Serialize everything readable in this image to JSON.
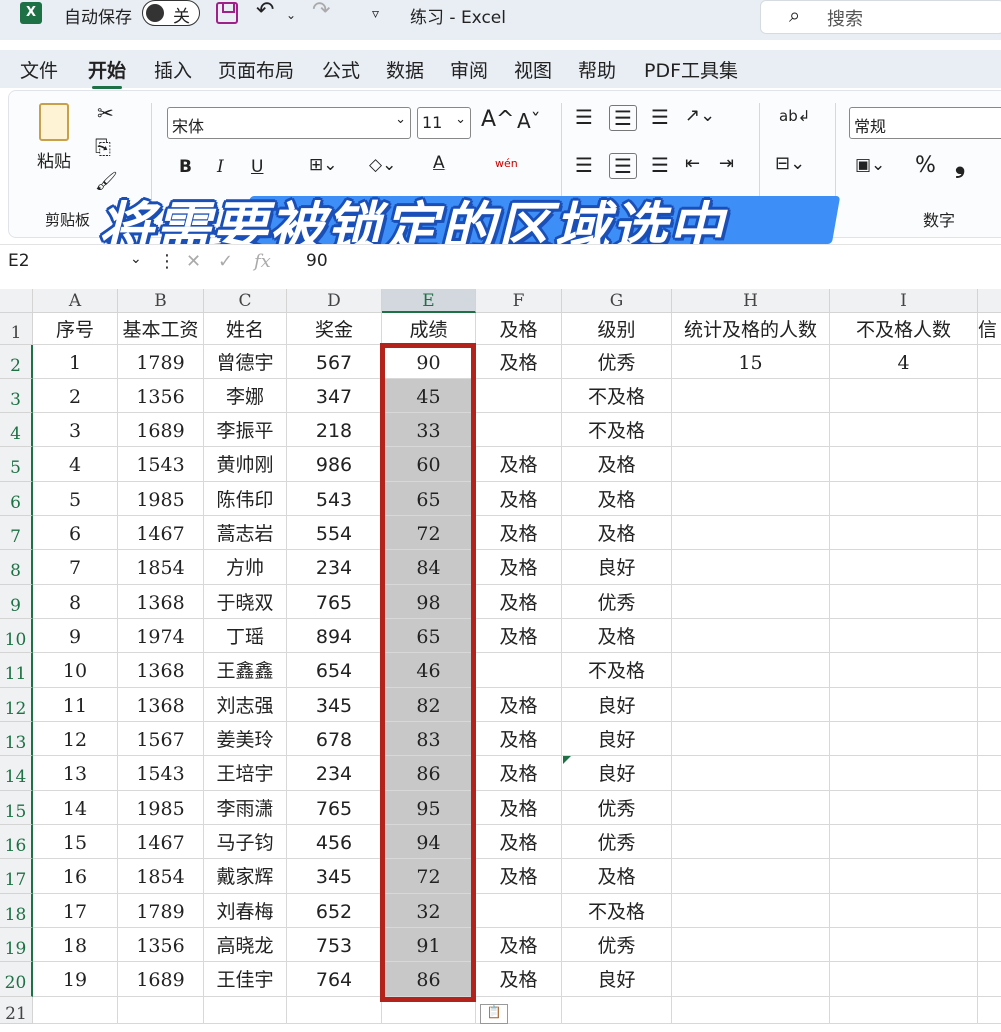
{
  "titlebar": {
    "autosave_label": "自动保存",
    "autosave_state": "关",
    "doc_title": "练习  -  Excel",
    "search_placeholder": "搜索",
    "app_icon": "X"
  },
  "menu": [
    "文件",
    "开始",
    "插入",
    "页面布局",
    "公式",
    "数据",
    "审阅",
    "视图",
    "帮助",
    "PDF工具集"
  ],
  "ribbon": {
    "paste_label": "粘贴",
    "clipboard_group": "剪贴板",
    "font_name": "宋体",
    "font_size": "11",
    "grow_font": "A^",
    "shrink_font": "Aˇ",
    "bold": "B",
    "italic": "I",
    "underline": "U",
    "font_color": "A",
    "phonetic": "wén",
    "number_format": "常规",
    "number_group": "数字",
    "percent": "%",
    "comma": "❟"
  },
  "banner_text": "将需要被锁定的区域选中",
  "formula_bar": {
    "name_box": "E2",
    "fx": "fx",
    "value": "90"
  },
  "columns": [
    "A",
    "B",
    "C",
    "D",
    "E",
    "F",
    "G",
    "H",
    "I"
  ],
  "selected_column": "E",
  "header_row": [
    "序号",
    "基本工资",
    "姓名",
    "奖金",
    "成绩",
    "及格",
    "级别",
    "统计及格的人数",
    "不及格人数",
    "信"
  ],
  "rows": [
    [
      "1",
      "1789",
      "曾德宇",
      "567",
      "90",
      "及格",
      "优秀",
      "15",
      "4"
    ],
    [
      "2",
      "1356",
      "李娜",
      "347",
      "45",
      "",
      "不及格",
      "",
      ""
    ],
    [
      "3",
      "1689",
      "李振平",
      "218",
      "33",
      "",
      "不及格",
      "",
      ""
    ],
    [
      "4",
      "1543",
      "黄帅刚",
      "986",
      "60",
      "及格",
      "及格",
      "",
      ""
    ],
    [
      "5",
      "1985",
      "陈伟印",
      "543",
      "65",
      "及格",
      "及格",
      "",
      ""
    ],
    [
      "6",
      "1467",
      "蒿志岩",
      "554",
      "72",
      "及格",
      "及格",
      "",
      ""
    ],
    [
      "7",
      "1854",
      "方帅",
      "234",
      "84",
      "及格",
      "良好",
      "",
      ""
    ],
    [
      "8",
      "1368",
      "于晓双",
      "765",
      "98",
      "及格",
      "优秀",
      "",
      ""
    ],
    [
      "9",
      "1974",
      "丁瑶",
      "894",
      "65",
      "及格",
      "及格",
      "",
      ""
    ],
    [
      "10",
      "1368",
      "王鑫鑫",
      "654",
      "46",
      "",
      "不及格",
      "",
      ""
    ],
    [
      "11",
      "1368",
      "刘志强",
      "345",
      "82",
      "及格",
      "良好",
      "",
      ""
    ],
    [
      "12",
      "1567",
      "姜美玲",
      "678",
      "83",
      "及格",
      "良好",
      "",
      ""
    ],
    [
      "13",
      "1543",
      "王培宇",
      "234",
      "86",
      "及格",
      "良好",
      "",
      ""
    ],
    [
      "14",
      "1985",
      "李雨潇",
      "765",
      "95",
      "及格",
      "优秀",
      "",
      ""
    ],
    [
      "15",
      "1467",
      "马子钧",
      "456",
      "94",
      "及格",
      "优秀",
      "",
      ""
    ],
    [
      "16",
      "1854",
      "戴家辉",
      "345",
      "72",
      "及格",
      "及格",
      "",
      ""
    ],
    [
      "17",
      "1789",
      "刘春梅",
      "652",
      "32",
      "",
      "不及格",
      "",
      ""
    ],
    [
      "18",
      "1356",
      "高晓龙",
      "753",
      "91",
      "及格",
      "优秀",
      "",
      ""
    ],
    [
      "19",
      "1689",
      "王佳宇",
      "764",
      "86",
      "及格",
      "良好",
      "",
      ""
    ]
  ],
  "row_numbers": [
    "1",
    "2",
    "3",
    "4",
    "5",
    "6",
    "7",
    "8",
    "9",
    "10",
    "11",
    "12",
    "13",
    "14",
    "15",
    "16",
    "17",
    "18",
    "19",
    "20",
    "21"
  ]
}
